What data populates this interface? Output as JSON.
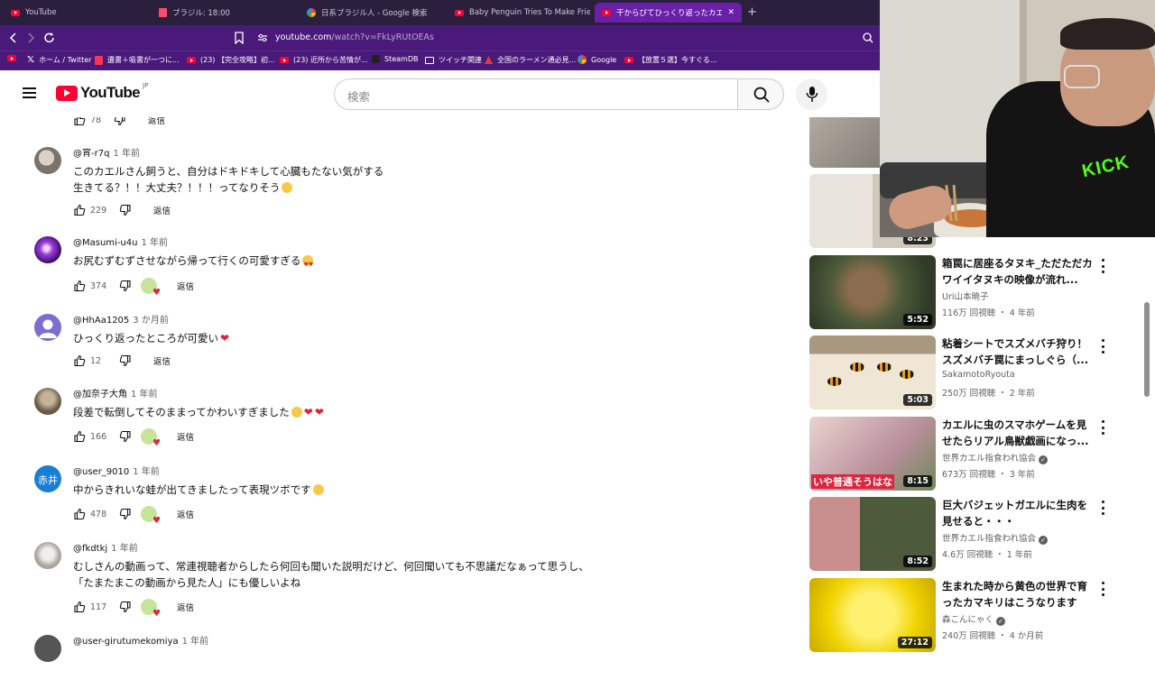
{
  "tabs": [
    {
      "label": "YouTube",
      "icon": "youtube"
    },
    {
      "label": "ブラジル: 18:00",
      "icon": "doc"
    },
    {
      "label": "日系ブラジル人 - Google 検索",
      "icon": "google"
    },
    {
      "label": "Baby Penguin Tries To Make Friends |",
      "icon": "youtube"
    },
    {
      "label": "干からびてひっくり返ったカエルに水を",
      "icon": "youtube",
      "active": true
    }
  ],
  "tab_close": "✕",
  "new_tab": "+",
  "address": {
    "domain": "youtube.com",
    "path": "/watch?v=FkLyRUtOEAs"
  },
  "bookmarks": [
    {
      "label": "ホーム / Twitter",
      "icon": "x"
    },
    {
      "label": "遺書＋吸書が一つに...",
      "icon": "red"
    },
    {
      "label": "(23) 【完全攻略】初...",
      "icon": "youtube"
    },
    {
      "label": "(23) 近所から苦情が...",
      "icon": "youtube"
    },
    {
      "label": "SteamDB",
      "icon": "steam"
    },
    {
      "label": "ツイッチ関連",
      "icon": "folder"
    },
    {
      "label": "全国のラーメン通必見...",
      "icon": "red"
    },
    {
      "label": "Google",
      "icon": "google"
    },
    {
      "label": "【放置５選】今すぐる...",
      "icon": "youtube"
    }
  ],
  "masthead": {
    "logo_text": "YouTube",
    "region": "JP",
    "search_placeholder": "検索"
  },
  "comments_top": {
    "likes": "78",
    "reply": "返信"
  },
  "comments": [
    {
      "author": "@宵-r7q",
      "time": "1 年前",
      "lines": [
        "このカエルさん飼うと、自分はドキドキして心臓もたない気がする",
        "生きてる？！！大丈夫？！！！ってなりそう"
      ],
      "emoji": [
        "laugh"
      ],
      "likes": "229",
      "reply": "返信",
      "creator_heart": false,
      "avatar": "photo-grey"
    },
    {
      "author": "@Masumi-u4u",
      "time": "1 年前",
      "lines": [
        "お尻むずむずさせながら帰って行くの可愛すぎる"
      ],
      "emoji": [
        "heart-eyes"
      ],
      "likes": "374",
      "reply": "返信",
      "creator_heart": true,
      "avatar": "purple"
    },
    {
      "author": "@HhAa1205",
      "time": "3 か月前",
      "lines": [
        "ひっくり返ったところが可愛い"
      ],
      "emoji": [
        "heart"
      ],
      "likes": "12",
      "reply": "返信",
      "creator_heart": false,
      "avatar": "default"
    },
    {
      "author": "@加奈子大角",
      "time": "1 年前",
      "lines": [
        "段差で転倒してそのままってかわいすぎました"
      ],
      "emoji": [
        "laugh",
        "heart",
        "heart"
      ],
      "likes": "166",
      "reply": "返信",
      "creator_heart": true,
      "avatar": "photo-brown"
    },
    {
      "author": "@user_9010",
      "time": "1 年前",
      "lines": [
        "中からきれいな蛙が出てきましたって表現ツボです"
      ],
      "emoji": [
        "laugh"
      ],
      "likes": "478",
      "reply": "返信",
      "creator_heart": true,
      "avatar": "kanji",
      "avatar_text": "赤井"
    },
    {
      "author": "@fkdtkj",
      "time": "1 年前",
      "lines": [
        "むしさんの動画って、常連視聴者からしたら何回も聞いた説明だけど、何回聞いても不思議だなぁって思うし、",
        "「たまたまこの動画から見た人」にも優しいよね"
      ],
      "emoji": [],
      "likes": "117",
      "reply": "返信",
      "creator_heart": true,
      "avatar": "photo-cat"
    },
    {
      "author": "@user-girutumekomiya",
      "time": "1 年前",
      "lines": [],
      "emoji": [],
      "likes": "",
      "reply": "",
      "creator_heart": false,
      "avatar": "photo-dark"
    }
  ],
  "sidebar": [
    {
      "title": "",
      "channel": "",
      "views": "",
      "age": "",
      "duration": "",
      "thumb": "cat"
    },
    {
      "title": "",
      "channel": "",
      "views": "",
      "age": "",
      "duration": "8:23",
      "thumb": "egg"
    },
    {
      "title": "箱罠に居座るタヌキ_ただただカワイイタヌキの映像が流れ...",
      "channel": "Uri山本暁子",
      "verified": false,
      "views": "116万 回視聴",
      "age": "4 年前",
      "duration": "5:52",
      "thumb": "tanuki"
    },
    {
      "title": "粘着シートでスズメバチ狩り！スズメバチ罠にまっしぐら（...",
      "channel": "SakamotoRyouta",
      "verified": false,
      "views": "250万 回視聴",
      "age": "2 年前",
      "duration": "5:03",
      "thumb": "hornet"
    },
    {
      "title": "カエルに虫のスマホゲームを見せたらリアル鳥獣戯画になっ...",
      "channel": "世界カエル指食われ協会",
      "verified": true,
      "views": "673万 回視聴",
      "age": "3 年前",
      "duration": "8:15",
      "thumb": "frog-phone",
      "overlay": "いや普通そうはな"
    },
    {
      "title": "巨大バジェットガエルに生肉を見せると・・・",
      "channel": "世界カエル指食われ協会",
      "verified": true,
      "views": "4.6万 回視聴",
      "age": "1 年前",
      "duration": "8:52",
      "thumb": "big-frog"
    },
    {
      "title": "生まれた時から黄色の世界で育ったカマキリはこうなります",
      "channel": "森こんにゃく",
      "verified": true,
      "views": "240万 回視聴",
      "age": "4 か月前",
      "duration": "27:12",
      "thumb": "yellow"
    }
  ],
  "dot_separator": "・",
  "webcam": {
    "shirt_text": "KICK"
  }
}
